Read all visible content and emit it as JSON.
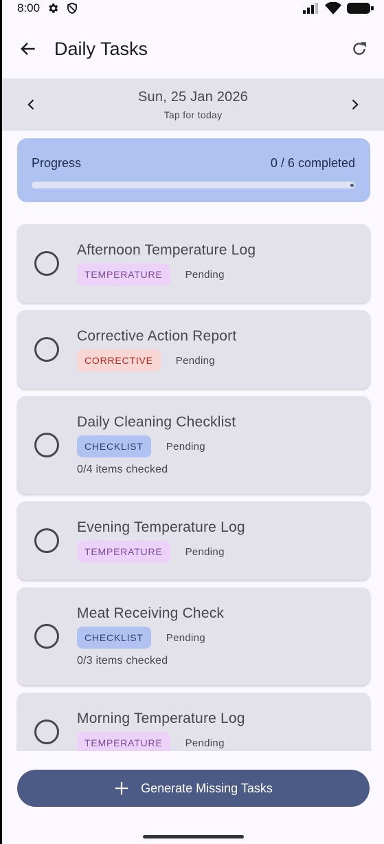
{
  "status_bar": {
    "time": "8:00",
    "left_icons": [
      "settings-icon",
      "shield-icon"
    ],
    "right_icons": [
      "signal-icon",
      "wifi-icon",
      "battery-icon"
    ]
  },
  "app_bar": {
    "title": "Daily Tasks",
    "back_icon": "arrow-back-icon",
    "refresh_icon": "refresh-icon"
  },
  "date_nav": {
    "date": "Sun, 25 Jan 2026",
    "hint": "Tap for today"
  },
  "progress": {
    "label": "Progress",
    "summary": "0 / 6 completed",
    "fraction": 0
  },
  "tasks": [
    {
      "title": "Afternoon Temperature Log",
      "type": "TEMPERATURE",
      "status": "Pending"
    },
    {
      "title": "Corrective Action Report",
      "type": "CORRECTIVE",
      "status": "Pending"
    },
    {
      "title": "Daily Cleaning Checklist",
      "type": "CHECKLIST",
      "status": "Pending",
      "items": "0/4 items checked"
    },
    {
      "title": "Evening Temperature Log",
      "type": "TEMPERATURE",
      "status": "Pending"
    },
    {
      "title": "Meat Receiving Check",
      "type": "CHECKLIST",
      "status": "Pending",
      "items": "0/3 items checked"
    },
    {
      "title": "Morning Temperature Log",
      "type": "TEMPERATURE",
      "status": "Pending"
    }
  ],
  "generate_button": {
    "label": "Generate Missing Tasks",
    "icon": "plus-icon"
  },
  "colors": {
    "background": "#fcf8ff",
    "card": "#e3e2ea",
    "progress_card": "#b0c2f1",
    "primary_button": "#4b5b86",
    "temperature_chip": "#ecd1f9",
    "corrective_chip": "#f8d6d3",
    "checklist_chip": "#b0c2f1"
  }
}
